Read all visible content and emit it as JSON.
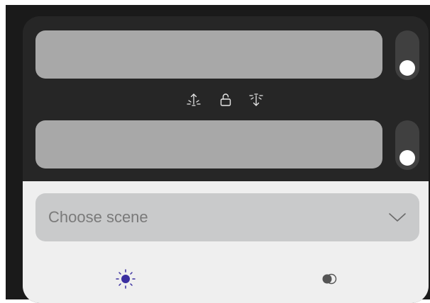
{
  "panel": {
    "scene_select": {
      "label": "Choose scene",
      "icon": "chevron-down-icon"
    },
    "toggles": [
      {
        "name": "top-toggle",
        "state": "off"
      },
      {
        "name": "bottom-toggle",
        "state": "off"
      }
    ],
    "middle_icons": [
      "tilt-up-icon",
      "lock-open-icon",
      "tilt-down-icon"
    ],
    "bottom_icons": [
      "brightness-icon",
      "color-temperature-icon"
    ],
    "colors": {
      "accent": "#3b2fa0",
      "dark_background": "#262626",
      "light_background": "#efefef",
      "slider": "#a8a8a8",
      "select": "#c9cacb"
    }
  }
}
